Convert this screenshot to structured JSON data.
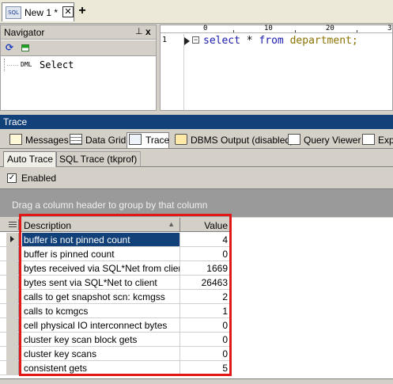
{
  "document_tab": {
    "icon": "sql-file-icon",
    "icon_text": "SQL",
    "label": "New 1 *",
    "close": "✕",
    "new_tab": "+"
  },
  "navigator": {
    "title": "Navigator",
    "pin": "⊥",
    "close": "x",
    "items": [
      {
        "tag": "DML",
        "label": "Select"
      }
    ]
  },
  "editor": {
    "ruler": {
      "marks": [
        "0",
        "10",
        "20",
        "3"
      ]
    },
    "line_number": "1",
    "code": {
      "kw1": "select",
      "star": " * ",
      "kw2": "from",
      "space": " ",
      "table": "department",
      "end": ";"
    }
  },
  "trace_panel": {
    "title": "Trace",
    "tabs": [
      {
        "label": "Messages",
        "icon": "messages-icon"
      },
      {
        "label": "Data Grid",
        "icon": "data-grid-icon"
      },
      {
        "label": "Trace",
        "icon": "trace-icon",
        "active": true
      },
      {
        "label": "DBMS Output (disabled)",
        "icon": "dbms-output-icon"
      },
      {
        "label": "Query Viewer",
        "icon": "query-viewer-icon"
      },
      {
        "label": "Exp",
        "icon": "explain-icon"
      }
    ],
    "subtabs": [
      {
        "label": "Auto Trace",
        "active": true
      },
      {
        "label": "SQL Trace (tkprof)",
        "active": false
      }
    ],
    "enabled": {
      "label": "Enabled",
      "checked": true,
      "check": "✓"
    },
    "group_hint": "Drag a column header to group by that column",
    "grid": {
      "headers": {
        "description": "Description",
        "value": "Value",
        "sort": "▲"
      },
      "rows": [
        {
          "description": "buffer is not pinned count",
          "value": "4"
        },
        {
          "description": "buffer is pinned count",
          "value": "0"
        },
        {
          "description": "bytes received via SQL*Net from client",
          "value": "1669"
        },
        {
          "description": "bytes sent via SQL*Net to client",
          "value": "26463"
        },
        {
          "description": "calls to get snapshot scn: kcmgss",
          "value": "2"
        },
        {
          "description": "calls to kcmgcs",
          "value": "1"
        },
        {
          "description": "cell physical IO interconnect bytes",
          "value": "0"
        },
        {
          "description": "cluster key scan block gets",
          "value": "0"
        },
        {
          "description": "cluster key scans",
          "value": "0"
        },
        {
          "description": "consistent gets",
          "value": "5"
        }
      ]
    }
  },
  "colors": {
    "accent": "#12417a",
    "highlight": "#e11818",
    "keyword": "#1a1ab0",
    "identifier": "#8a7200"
  }
}
